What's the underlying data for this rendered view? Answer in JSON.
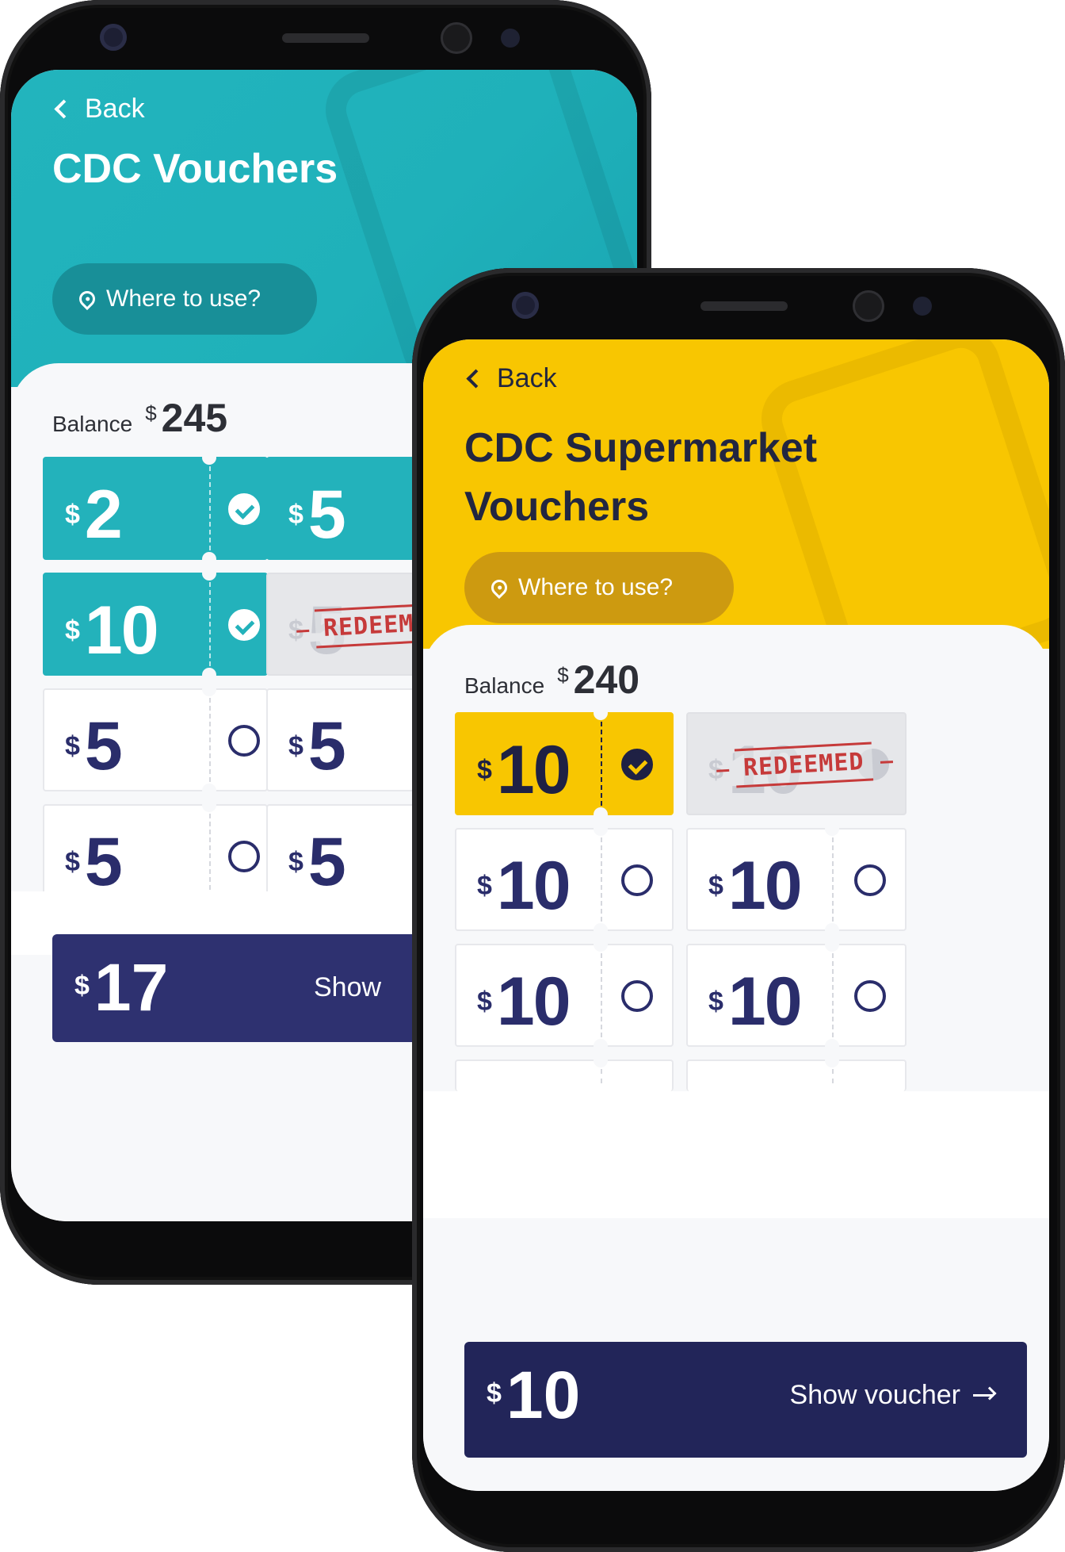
{
  "colors": {
    "teal": "#22b4bd",
    "yellow": "#f8c601",
    "navy": "#2e3170",
    "redeemed_red": "#c63a3a"
  },
  "phone_back": {
    "back_label": "Back",
    "title": "CDC Vouchers",
    "where_label": "Where to use?",
    "balance_label": "Balance",
    "currency": "$",
    "balance_amount": "245",
    "vouchers": [
      {
        "value": "2",
        "state": "selected"
      },
      {
        "value": "5",
        "state": "selected"
      },
      {
        "value": "10",
        "state": "selected"
      },
      {
        "value": "5",
        "state": "redeemed"
      },
      {
        "value": "5",
        "state": "unselected"
      },
      {
        "value": "5",
        "state": "unselected"
      },
      {
        "value": "5",
        "state": "unselected"
      },
      {
        "value": "5",
        "state": "unselected"
      }
    ],
    "total": "17",
    "show_label": "Show"
  },
  "phone_front": {
    "back_label": "Back",
    "title_line1": "CDC Supermarket",
    "title_line2": "Vouchers",
    "where_label": "Where to use?",
    "balance_label": "Balance",
    "currency": "$",
    "balance_amount": "240",
    "redeemed_stamp": "REDEEMED",
    "vouchers": [
      {
        "value": "10",
        "state": "selected"
      },
      {
        "value": "10",
        "state": "redeemed"
      },
      {
        "value": "10",
        "state": "unselected"
      },
      {
        "value": "10",
        "state": "unselected"
      },
      {
        "value": "10",
        "state": "unselected"
      },
      {
        "value": "10",
        "state": "unselected"
      }
    ],
    "total": "10",
    "show_label": "Show voucher"
  }
}
